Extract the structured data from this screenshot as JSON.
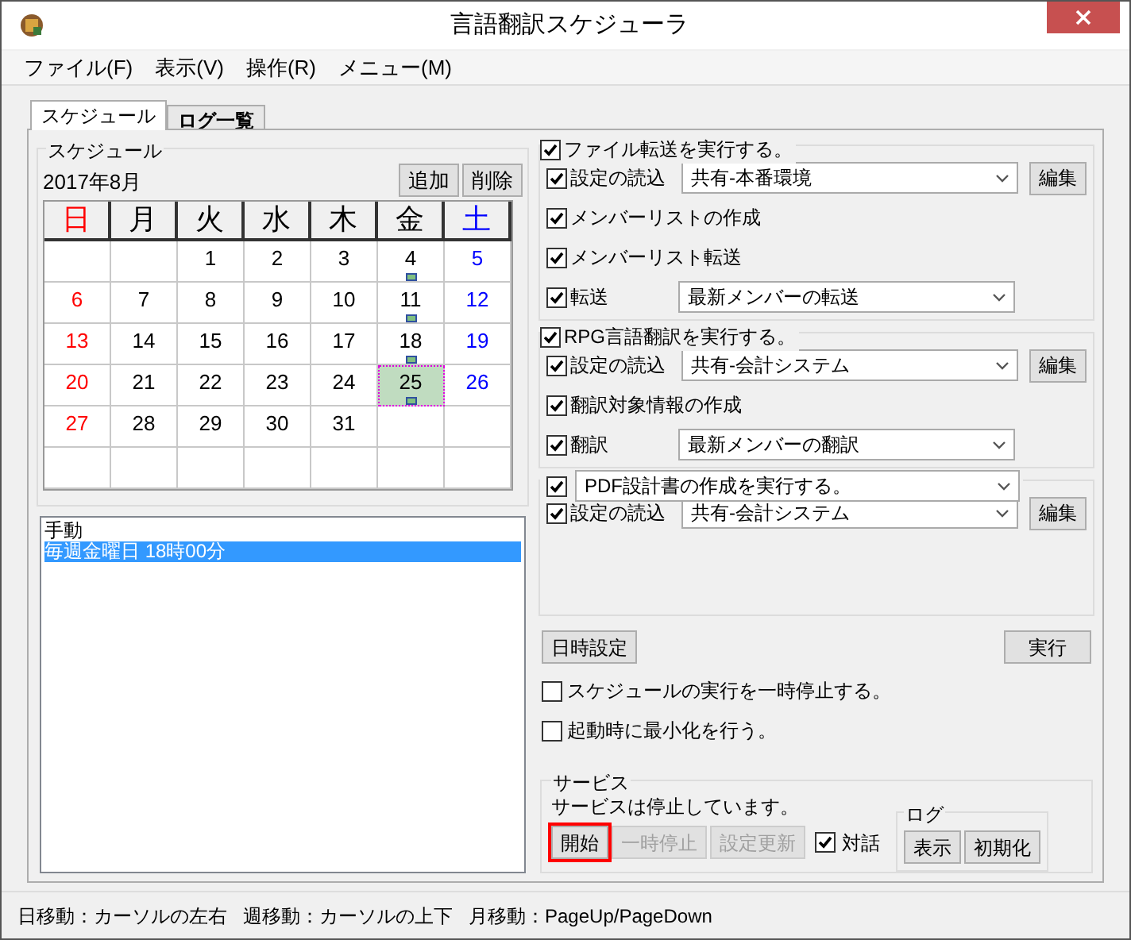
{
  "window": {
    "title": "言語翻訳スケジューラ"
  },
  "menu": [
    "ファイル(F)",
    "表示(V)",
    "操作(R)",
    "メニュー(M)"
  ],
  "tabs": [
    {
      "label": "スケジュール",
      "selected": true
    },
    {
      "label": "ログ一覧",
      "selected": false
    }
  ],
  "calendar": {
    "group_title": "スケジュール",
    "month": "2017年8月",
    "buttons": [
      "追加",
      "削除"
    ],
    "weekdays": [
      {
        "label": "日",
        "color": "#ff0000"
      },
      {
        "label": "月",
        "color": "#000000"
      },
      {
        "label": "火",
        "color": "#000000"
      },
      {
        "label": "水",
        "color": "#000000"
      },
      {
        "label": "木",
        "color": "#000000"
      },
      {
        "label": "金",
        "color": "#000000"
      },
      {
        "label": "土",
        "color": "#0000ff"
      }
    ],
    "weeks": [
      [
        {
          "day": "1",
          "marker": false,
          "selected": false
        },
        {
          "day": "2",
          "marker": false,
          "selected": false
        },
        {
          "day": "3",
          "marker": false,
          "selected": false
        },
        {
          "day": "4",
          "marker": true,
          "selected": false
        },
        {
          "day": "5",
          "marker": false,
          "selected": false
        }
      ],
      [
        {
          "day": "6",
          "marker": false,
          "selected": false
        },
        {
          "day": "7",
          "marker": false,
          "selected": false
        },
        {
          "day": "8",
          "marker": false,
          "selected": false
        },
        {
          "day": "9",
          "marker": false,
          "selected": false
        },
        {
          "day": "10",
          "marker": false,
          "selected": false
        },
        {
          "day": "11",
          "marker": true,
          "selected": false
        },
        {
          "day": "12",
          "marker": false,
          "selected": false
        }
      ],
      [
        {
          "day": "13",
          "marker": false,
          "selected": false
        },
        {
          "day": "14",
          "marker": false,
          "selected": false
        },
        {
          "day": "15",
          "marker": false,
          "selected": false
        },
        {
          "day": "16",
          "marker": false,
          "selected": false
        },
        {
          "day": "17",
          "marker": false,
          "selected": false
        },
        {
          "day": "18",
          "marker": true,
          "selected": false
        },
        {
          "day": "19",
          "marker": false,
          "selected": false
        }
      ],
      [
        {
          "day": "20",
          "marker": false,
          "selected": false
        },
        {
          "day": "21",
          "marker": false,
          "selected": false
        },
        {
          "day": "22",
          "marker": false,
          "selected": false
        },
        {
          "day": "23",
          "marker": false,
          "selected": false
        },
        {
          "day": "24",
          "marker": false,
          "selected": false
        },
        {
          "day": "25",
          "marker": true,
          "selected": true
        },
        {
          "day": "26",
          "marker": false,
          "selected": false
        }
      ],
      [
        {
          "day": "27",
          "marker": false,
          "selected": false
        },
        {
          "day": "28",
          "marker": false,
          "selected": false
        },
        {
          "day": "29",
          "marker": false,
          "selected": false
        },
        {
          "day": "30",
          "marker": false,
          "selected": false
        },
        {
          "day": "31",
          "marker": false,
          "selected": false
        }
      ]
    ]
  },
  "schedule_list": [
    {
      "text": "手動",
      "selected": false
    },
    {
      "text": "毎週金曜日 18時00分",
      "selected": true
    }
  ],
  "sections": [
    {
      "header": {
        "kind": "check",
        "label": "ファイル転送を実行する。",
        "checked": true
      },
      "rows": [
        {
          "kind": "select",
          "label": "設定の読込",
          "checked": true,
          "value": "共有-本番環境",
          "button": "編集"
        },
        {
          "kind": "check",
          "label": "メンバーリストの作成",
          "checked": true
        },
        {
          "kind": "check",
          "label": "メンバーリスト転送",
          "checked": true
        },
        {
          "kind": "select",
          "label": "転送",
          "checked": true,
          "value": "最新メンバーの転送"
        }
      ]
    },
    {
      "header": {
        "kind": "check",
        "label": "RPG言語翻訳を実行する。",
        "checked": true
      },
      "rows": [
        {
          "kind": "select",
          "label": "設定の読込",
          "checked": true,
          "value": "共有-会計システム",
          "button": "編集"
        },
        {
          "kind": "check",
          "label": "翻訳対象情報の作成",
          "checked": true
        },
        {
          "kind": "select",
          "label": "翻訳",
          "checked": true,
          "value": "最新メンバーの翻訳"
        }
      ]
    },
    {
      "header": {
        "kind": "select",
        "label": "PDF設計書の作成を実行する。",
        "checked": true
      },
      "rows": [
        {
          "kind": "select",
          "label": "設定の読込",
          "checked": true,
          "value": "共有-会計システム",
          "button": "編集"
        }
      ]
    }
  ],
  "datetime_button": "日時設定",
  "run_button": "実行",
  "options": [
    {
      "label": "スケジュールの実行を一時停止する。",
      "checked": false
    },
    {
      "label": "起動時に最小化を行う。",
      "checked": false
    }
  ],
  "service": {
    "title": "サービス",
    "status": "サービスは停止しています。",
    "buttons": [
      {
        "label": "開始",
        "disabled": false,
        "highlighted": true
      },
      {
        "label": "一時停止",
        "disabled": true,
        "highlighted": false
      },
      {
        "label": "設定更新",
        "disabled": true,
        "highlighted": false
      }
    ],
    "dialog_check": {
      "label": "対話",
      "checked": true
    },
    "log": {
      "title": "ログ",
      "buttons": [
        "表示",
        "初期化"
      ]
    }
  },
  "status_bar": [
    "日移動：カーソルの左右",
    "週移動：カーソルの上下",
    "月移動：PageUp/PageDown"
  ]
}
